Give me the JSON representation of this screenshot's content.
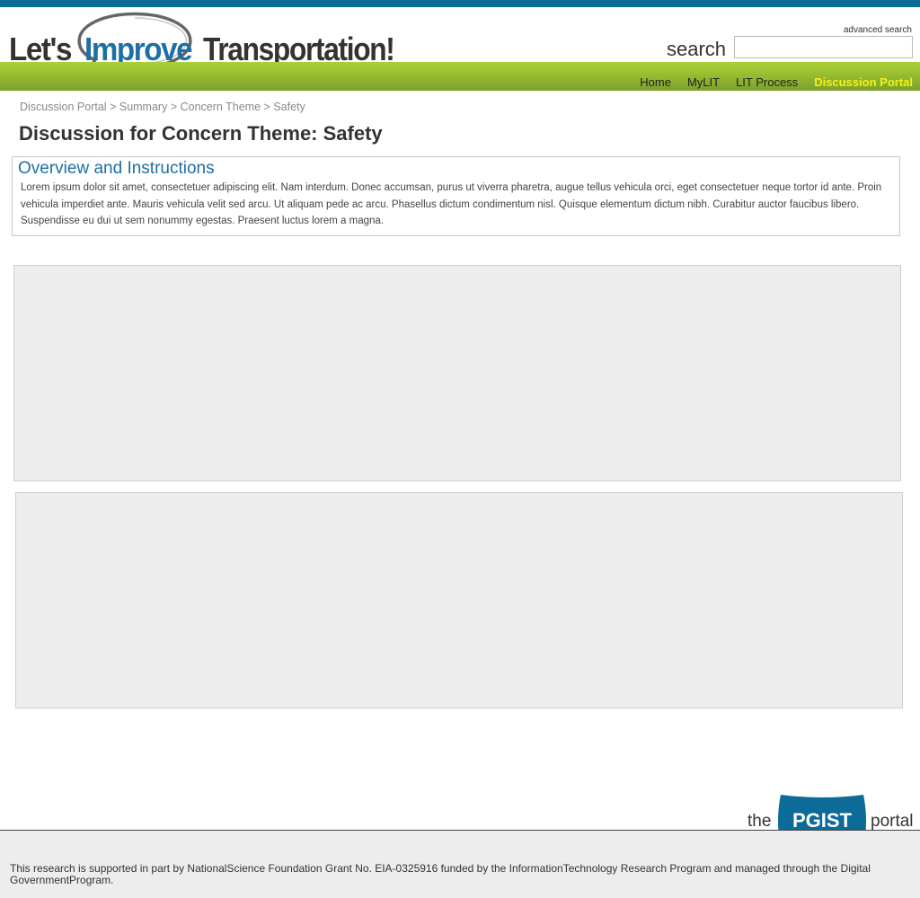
{
  "brand": {
    "logo_lets": "Let's",
    "logo_improve": "Improve",
    "logo_transportation": "Transportation!"
  },
  "search": {
    "advanced_label": "advanced search",
    "label": "search",
    "value": "",
    "placeholder": ""
  },
  "nav": {
    "items": [
      {
        "label": "Home"
      },
      {
        "label": "MyLIT"
      },
      {
        "label": "LIT Process"
      },
      {
        "label": "Discussion Portal"
      }
    ],
    "active_color": "#f4f21a"
  },
  "breadcrumb": {
    "items": [
      "Discussion Portal",
      "Summary",
      "Concern Theme",
      "Safety"
    ],
    "separator": ">"
  },
  "page": {
    "title": "Discussion for Concern Theme: Safety"
  },
  "overview": {
    "heading": "Overview and Instructions",
    "body": "Lorem ipsum dolor sit amet, consectetuer adipiscing elit. Nam interdum. Donec accumsan, purus ut viverra pharetra, augue tellus vehicula orci, eget consectetuer neque tortor id ante. Proin vehicula imperdiet ante. Mauris vehicula velit sed arcu. Ut aliquam pede ac arcu. Phasellus dictum condimentum nisl. Quisque elementum dictum nibh. Curabitur auctor faucibus libero. Suspendisse eu dui ut sem nonummy egestas. Praesent luctus lorem a magna."
  },
  "pgist": {
    "the": "the",
    "badge": "PGIST",
    "portal": "portal"
  },
  "footer": {
    "text": "This research is supported in part by NationalScience Foundation Grant No. EIA-0325916 funded by the InformationTechnology Research Program and managed through the Digital GovernmentProgram."
  },
  "colors": {
    "top_bar": "#0d6b99",
    "accent_blue": "#1d6fa5",
    "green_bar": "#9cc232",
    "panel_bg": "#ededed"
  }
}
